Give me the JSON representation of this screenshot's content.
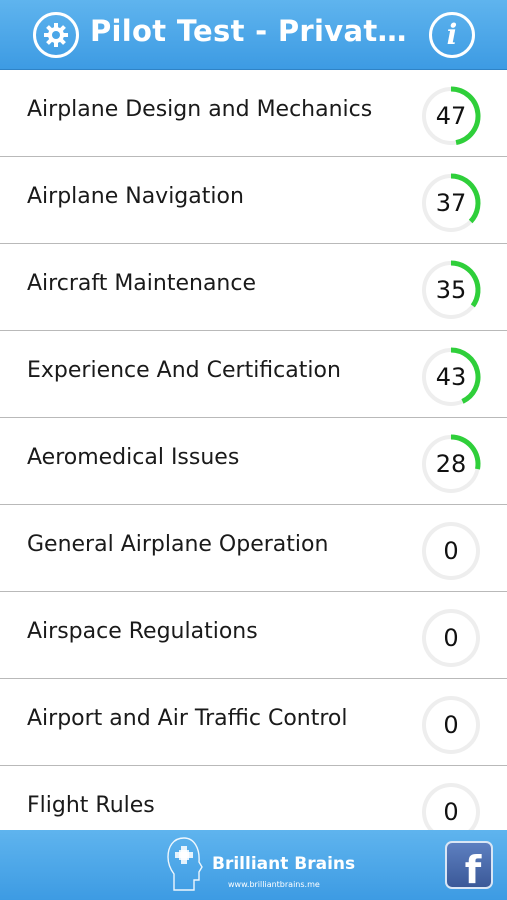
{
  "header": {
    "title": "Pilot Test - Private P...",
    "settings_icon": "gear-icon",
    "info_icon": "info-icon",
    "info_glyph": "i"
  },
  "colors": {
    "accent": "#3d9be3",
    "progress": "#2fcf3a",
    "track": "#eeeeee"
  },
  "topics": [
    {
      "label": "Airplane Design and Mechanics",
      "score": "47"
    },
    {
      "label": "Airplane Navigation",
      "score": "37"
    },
    {
      "label": "Aircraft Maintenance",
      "score": "35"
    },
    {
      "label": "Experience And Certification",
      "score": "43"
    },
    {
      "label": "Aeromedical Issues",
      "score": "28"
    },
    {
      "label": "General Airplane Operation",
      "score": "0"
    },
    {
      "label": "Airspace Regulations",
      "score": "0"
    },
    {
      "label": "Airport and Air Traffic Control",
      "score": "0"
    },
    {
      "label": "Flight Rules",
      "score": "0"
    }
  ],
  "footer": {
    "brand_name": "Brilliant Brains",
    "brand_url": "www.brilliantbrains.me",
    "facebook_glyph": "f"
  }
}
